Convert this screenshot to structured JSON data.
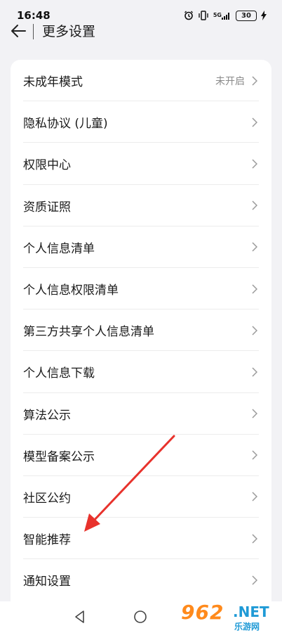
{
  "status_bar": {
    "time": "16:48",
    "network": "5G",
    "battery": "30"
  },
  "header": {
    "title": "更多设置"
  },
  "settings": {
    "items": [
      {
        "label": "未成年模式",
        "value": "未开启"
      },
      {
        "label": "隐私协议 (儿童)"
      },
      {
        "label": "权限中心"
      },
      {
        "label": "资质证照"
      },
      {
        "label": "个人信息清单"
      },
      {
        "label": "个人信息权限清单"
      },
      {
        "label": "第三方共享个人信息清单"
      },
      {
        "label": "个人信息下载"
      },
      {
        "label": "算法公示"
      },
      {
        "label": "模型备案公示"
      },
      {
        "label": "社区公约"
      },
      {
        "label": "智能推荐"
      },
      {
        "label": "通知设置"
      }
    ]
  },
  "watermark": {
    "number": "962",
    "domain": ".NET",
    "name": "乐游网"
  },
  "colors": {
    "background": "#f2f2f5",
    "card": "#ffffff",
    "annotation_arrow": "#e8322c",
    "watermark_orange": "#ff8a1c",
    "watermark_blue": "#1f9ad6"
  }
}
